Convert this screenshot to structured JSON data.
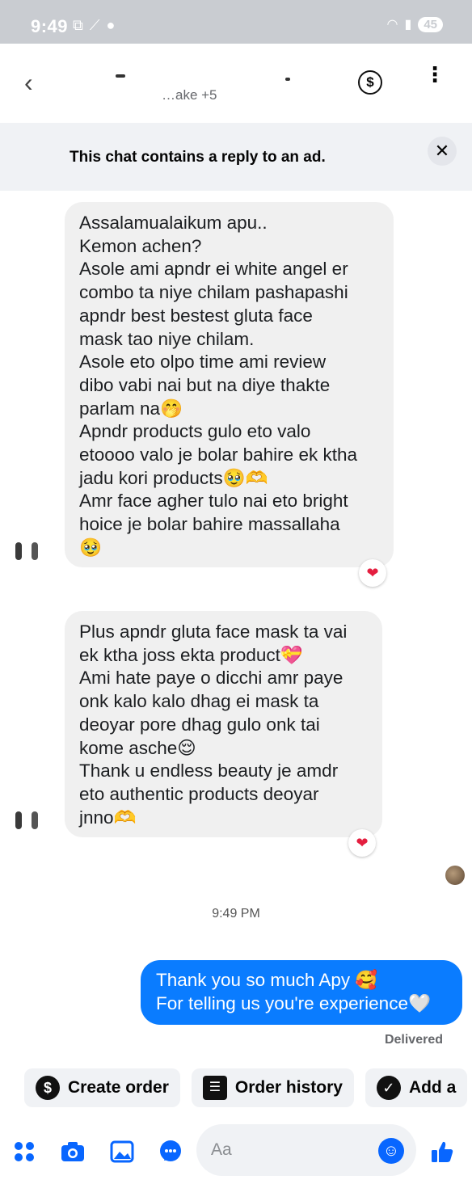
{
  "status": {
    "time": "9:49",
    "icons": [
      "screenshot-icon",
      "signal-icon",
      "chat-icon"
    ],
    "battery": "45"
  },
  "header": {
    "contact_sub": "…ake +5",
    "dollar_symbol": "$"
  },
  "ad_banner": {
    "text": "This chat contains a reply to an ad.",
    "close_symbol": "✕"
  },
  "messages": [
    {
      "direction": "incoming",
      "lines": [
        "Assalamualaikum apu..",
        "Kemon achen?",
        "Asole ami apndr ei white angel er",
        "combo ta niye chilam pashapashi",
        "apndr best bestest gluta face",
        "mask tao niye chilam.",
        "Asole eto olpo time ami review",
        "dibo vabi nai but na diye thakte",
        "parlam na🤭",
        "Apndr products gulo eto valo",
        "etoooo valo je bolar bahire ek ktha",
        "jadu kori products🥹🫶",
        "Amr face agher tulo nai eto bright",
        "hoice je bolar bahire massallaha",
        "🥹"
      ],
      "reaction": "❤"
    },
    {
      "direction": "incoming",
      "lines": [
        "Plus apndr gluta face mask ta vai",
        "ek ktha joss ekta product💝",
        "Ami hate paye o dicchi amr paye",
        "onk kalo kalo dhag ei mask ta",
        "deoyar pore dhag gulo onk tai",
        "kome asche😌",
        "Thank u endless beauty je amdr",
        "eto authentic products deoyar",
        "jnno🫶"
      ],
      "reaction": "❤"
    }
  ],
  "timestamp": "9:49 PM",
  "outgoing": {
    "lines": [
      "Thank you so much Apy 🥰",
      "For telling us you're experience🤍"
    ],
    "status": "Delivered"
  },
  "quick_actions": [
    {
      "icon": "dollar-icon",
      "symbol": "$",
      "label": "Create order"
    },
    {
      "icon": "list-icon",
      "symbol": "☰",
      "label": "Order history"
    },
    {
      "icon": "check-icon",
      "symbol": "✓",
      "label": "Add a"
    }
  ],
  "composer": {
    "placeholder": "Aa",
    "icons": [
      "apps-icon",
      "camera-icon",
      "gallery-icon",
      "voice-icon",
      "emoji-icon",
      "thumbs-up-icon"
    ]
  }
}
